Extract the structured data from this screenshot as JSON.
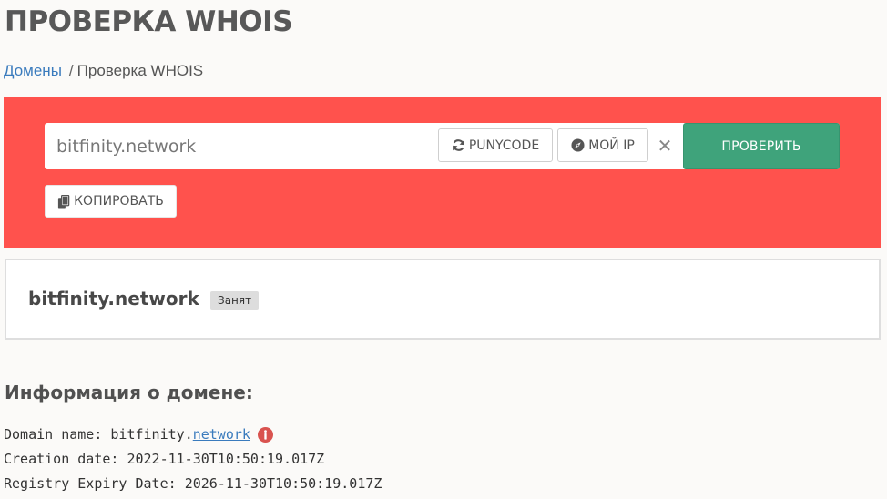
{
  "page": {
    "title": "ПРОВЕРКА WHOIS"
  },
  "breadcrumb": {
    "home_label": "Домены",
    "separator": "/",
    "current_label": "Проверка WHOIS"
  },
  "search": {
    "value": "bitfinity.network",
    "punycode_label": "PUNYCODE",
    "punycode_icon": "refresh-icon",
    "myip_label": "МОЙ IP",
    "myip_icon": "compass-icon",
    "clear_label": "✕",
    "submit_label": "ПРОВЕРИТЬ",
    "copy_label": "КОПИРОВАТЬ",
    "copy_icon": "copy-icon"
  },
  "result": {
    "domain": "bitfinity.network",
    "status": "Занят"
  },
  "info": {
    "heading": "Информация о домене:",
    "lines": [
      {
        "key": "Domain name:",
        "name": "bitfinity",
        "dot": ".",
        "tld": "network",
        "icon": "info-icon"
      },
      {
        "key": "Creation date:",
        "value": "2022-11-30T10:50:19.017Z"
      },
      {
        "key": "Registry Expiry Date:",
        "value": "2026-11-30T10:50:19.017Z"
      }
    ]
  },
  "colors": {
    "panel": "#ff524d",
    "primary_button": "#3fa37b",
    "link": "#3a7bbd",
    "info_icon": "#d9534f"
  }
}
